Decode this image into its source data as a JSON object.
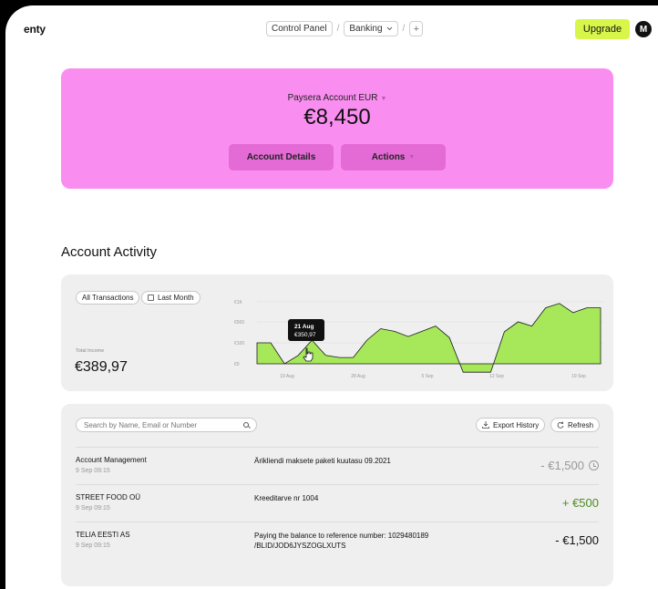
{
  "header": {
    "logo": "enty",
    "breadcrumbs": [
      "Control Panel",
      "Banking"
    ],
    "add_label": "+",
    "upgrade_label": "Upgrade",
    "avatar_initial": "M"
  },
  "account": {
    "name": "Paysera Account EUR",
    "balance": "€8,450",
    "details_label": "Account Details",
    "actions_label": "Actions"
  },
  "activity": {
    "title": "Account Activity",
    "filter_all": "All Transactions",
    "filter_period": "Last Month",
    "income_label": "Total Income",
    "income_value": "€389,97"
  },
  "chart_data": {
    "type": "area",
    "y_tick_labels": [
      "€1K",
      "€500",
      "€100",
      "€0"
    ],
    "y_ticks": [
      1000,
      500,
      100,
      0
    ],
    "x_tick_labels": [
      "19 Aug",
      "28 Aug",
      "5 Sep",
      "12 Sep",
      "19 Sep"
    ],
    "color": "#a6e85a",
    "values": [
      100,
      100,
      0,
      40,
      150,
      40,
      30,
      30,
      150,
      370,
      320,
      220,
      320,
      420,
      200,
      -40,
      -40,
      -40,
      310,
      500,
      420,
      850,
      960,
      730,
      850,
      850
    ],
    "tooltip": {
      "date": "21 Aug",
      "value": "€350,97"
    }
  },
  "transactions": {
    "search_placeholder": "Search by Name, Email or Number",
    "export_label": "Export History",
    "refresh_label": "Refresh",
    "rows": [
      {
        "name": "Account Management",
        "time": "9 Sep 09:15",
        "desc": "Ärikliendi maksete paketi kuutasu 09.2021",
        "amount": "- €1,500",
        "status": "pending"
      },
      {
        "name": "STREET FOOD OÜ",
        "time": "9 Sep 09:15",
        "desc": "Kreeditarve nr 1004",
        "amount": "+ €500",
        "status": "credit"
      },
      {
        "name": "TELIA EESTI AS",
        "time": "9 Sep 09:15",
        "desc": "Paying the balance to reference number: 1029480189 /BLID/JOD6JYSZOGLXUTS",
        "amount": "- €1,500",
        "status": "debit"
      }
    ]
  }
}
